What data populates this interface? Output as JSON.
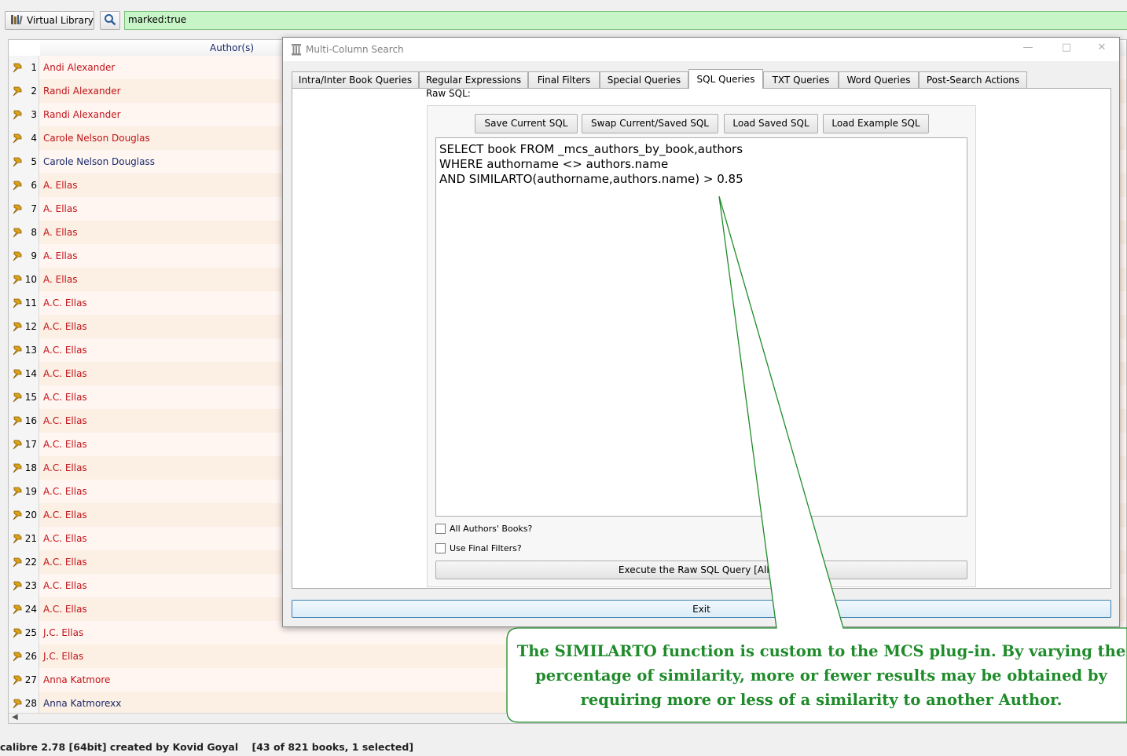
{
  "topbar": {
    "virtual_library_label": "Virtual Library",
    "search_value": "marked:true"
  },
  "booklist": {
    "column_header": "Author(s)",
    "rows": [
      {
        "num": "1",
        "author": "Andi Alexander",
        "color": "red"
      },
      {
        "num": "2",
        "author": "Randi Alexander",
        "color": "red"
      },
      {
        "num": "3",
        "author": "Randi Alexander",
        "color": "red"
      },
      {
        "num": "4",
        "author": "Carole Nelson Douglas",
        "color": "red"
      },
      {
        "num": "5",
        "author": "Carole Nelson Douglass",
        "color": "blue"
      },
      {
        "num": "6",
        "author": "A. Ellas",
        "color": "red"
      },
      {
        "num": "7",
        "author": "A. Ellas",
        "color": "red"
      },
      {
        "num": "8",
        "author": "A. Ellas",
        "color": "red"
      },
      {
        "num": "9",
        "author": "A. Ellas",
        "color": "red"
      },
      {
        "num": "10",
        "author": "A. Ellas",
        "color": "red"
      },
      {
        "num": "11",
        "author": "A.C. Ellas",
        "color": "red"
      },
      {
        "num": "12",
        "author": "A.C. Ellas",
        "color": "red"
      },
      {
        "num": "13",
        "author": "A.C. Ellas",
        "color": "red"
      },
      {
        "num": "14",
        "author": "A.C. Ellas",
        "color": "red"
      },
      {
        "num": "15",
        "author": "A.C. Ellas",
        "color": "red"
      },
      {
        "num": "16",
        "author": "A.C. Ellas",
        "color": "red"
      },
      {
        "num": "17",
        "author": "A.C. Ellas",
        "color": "red"
      },
      {
        "num": "18",
        "author": "A.C. Ellas",
        "color": "red"
      },
      {
        "num": "19",
        "author": "A.C. Ellas",
        "color": "red"
      },
      {
        "num": "20",
        "author": "A.C. Ellas",
        "color": "red"
      },
      {
        "num": "21",
        "author": "A.C. Ellas",
        "color": "red"
      },
      {
        "num": "22",
        "author": "A.C. Ellas",
        "color": "red"
      },
      {
        "num": "23",
        "author": "A.C. Ellas",
        "color": "red"
      },
      {
        "num": "24",
        "author": "A.C. Ellas",
        "color": "red"
      },
      {
        "num": "25",
        "author": "J.C. Ellas",
        "color": "red"
      },
      {
        "num": "26",
        "author": "J.C. Ellas",
        "color": "red"
      },
      {
        "num": "27",
        "author": "Anna Katmore",
        "color": "red"
      },
      {
        "num": "28",
        "author": "Anna Katmorexx",
        "color": "blue"
      }
    ]
  },
  "statusbar": {
    "text": "calibre 2.78 [64bit] created by Kovid Goyal    [43 of 821 books, 1 selected]"
  },
  "dialog": {
    "title": "Multi-Column Search",
    "tabs": [
      {
        "label": "Intra/Inter Book Queries",
        "active": false
      },
      {
        "label": "Regular Expressions",
        "active": false
      },
      {
        "label": "Final Filters",
        "active": false
      },
      {
        "label": "Special Queries",
        "active": false
      },
      {
        "label": "SQL Queries",
        "active": true
      },
      {
        "label": "TXT Queries",
        "active": false
      },
      {
        "label": "Word Queries",
        "active": false
      },
      {
        "label": "Post-Search Actions",
        "active": false
      }
    ],
    "raw_sql_label": "Raw SQL:",
    "buttons": {
      "save": "Save Current SQL",
      "swap": "Swap Current/Saved SQL",
      "load_saved": "Load Saved SQL",
      "load_example": "Load Example SQL"
    },
    "sql_text": "SELECT book FROM _mcs_authors_by_book,authors\nWHERE authorname <> authors.name\nAND SIMILARTO(authorname,authors.name) > 0.85",
    "all_authors_books_label": "All Authors' Books?",
    "all_authors_books_checked": false,
    "use_final_filters_label": "Use Final Filters?",
    "use_final_filters_checked": false,
    "execute_label": "Execute the Raw SQL Query [All Bo",
    "exit_label": "Exit"
  },
  "callout": {
    "text": "The SIMILARTO function is custom to the MCS plug-in.  By varying the percentage of similarity, more or fewer results may be obtained by requiring more or less of a similarity to another Author.",
    "color": "#1f8b2a"
  },
  "colors": {
    "author_red": "#c0141a",
    "author_blue": "#1a2a6b",
    "search_bg": "#c7f5c7"
  }
}
